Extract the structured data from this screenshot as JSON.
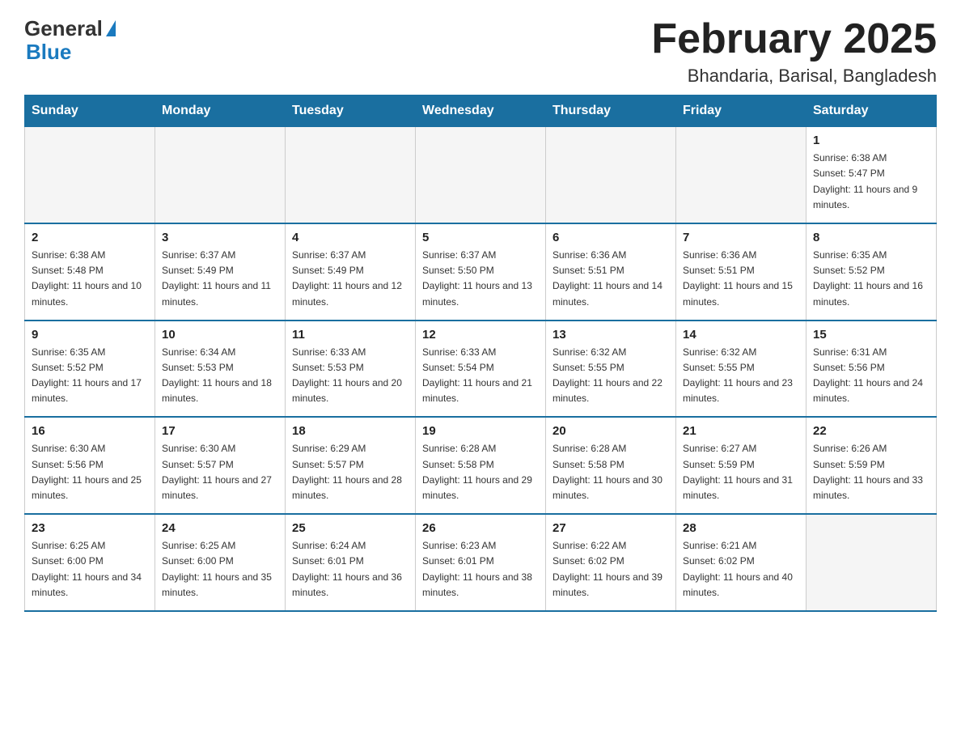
{
  "logo": {
    "general": "General",
    "blue": "Blue"
  },
  "title": "February 2025",
  "location": "Bhandaria, Barisal, Bangladesh",
  "days_of_week": [
    "Sunday",
    "Monday",
    "Tuesday",
    "Wednesday",
    "Thursday",
    "Friday",
    "Saturday"
  ],
  "weeks": [
    [
      {
        "day": "",
        "info": ""
      },
      {
        "day": "",
        "info": ""
      },
      {
        "day": "",
        "info": ""
      },
      {
        "day": "",
        "info": ""
      },
      {
        "day": "",
        "info": ""
      },
      {
        "day": "",
        "info": ""
      },
      {
        "day": "1",
        "info": "Sunrise: 6:38 AM\nSunset: 5:47 PM\nDaylight: 11 hours and 9 minutes."
      }
    ],
    [
      {
        "day": "2",
        "info": "Sunrise: 6:38 AM\nSunset: 5:48 PM\nDaylight: 11 hours and 10 minutes."
      },
      {
        "day": "3",
        "info": "Sunrise: 6:37 AM\nSunset: 5:49 PM\nDaylight: 11 hours and 11 minutes."
      },
      {
        "day": "4",
        "info": "Sunrise: 6:37 AM\nSunset: 5:49 PM\nDaylight: 11 hours and 12 minutes."
      },
      {
        "day": "5",
        "info": "Sunrise: 6:37 AM\nSunset: 5:50 PM\nDaylight: 11 hours and 13 minutes."
      },
      {
        "day": "6",
        "info": "Sunrise: 6:36 AM\nSunset: 5:51 PM\nDaylight: 11 hours and 14 minutes."
      },
      {
        "day": "7",
        "info": "Sunrise: 6:36 AM\nSunset: 5:51 PM\nDaylight: 11 hours and 15 minutes."
      },
      {
        "day": "8",
        "info": "Sunrise: 6:35 AM\nSunset: 5:52 PM\nDaylight: 11 hours and 16 minutes."
      }
    ],
    [
      {
        "day": "9",
        "info": "Sunrise: 6:35 AM\nSunset: 5:52 PM\nDaylight: 11 hours and 17 minutes."
      },
      {
        "day": "10",
        "info": "Sunrise: 6:34 AM\nSunset: 5:53 PM\nDaylight: 11 hours and 18 minutes."
      },
      {
        "day": "11",
        "info": "Sunrise: 6:33 AM\nSunset: 5:53 PM\nDaylight: 11 hours and 20 minutes."
      },
      {
        "day": "12",
        "info": "Sunrise: 6:33 AM\nSunset: 5:54 PM\nDaylight: 11 hours and 21 minutes."
      },
      {
        "day": "13",
        "info": "Sunrise: 6:32 AM\nSunset: 5:55 PM\nDaylight: 11 hours and 22 minutes."
      },
      {
        "day": "14",
        "info": "Sunrise: 6:32 AM\nSunset: 5:55 PM\nDaylight: 11 hours and 23 minutes."
      },
      {
        "day": "15",
        "info": "Sunrise: 6:31 AM\nSunset: 5:56 PM\nDaylight: 11 hours and 24 minutes."
      }
    ],
    [
      {
        "day": "16",
        "info": "Sunrise: 6:30 AM\nSunset: 5:56 PM\nDaylight: 11 hours and 25 minutes."
      },
      {
        "day": "17",
        "info": "Sunrise: 6:30 AM\nSunset: 5:57 PM\nDaylight: 11 hours and 27 minutes."
      },
      {
        "day": "18",
        "info": "Sunrise: 6:29 AM\nSunset: 5:57 PM\nDaylight: 11 hours and 28 minutes."
      },
      {
        "day": "19",
        "info": "Sunrise: 6:28 AM\nSunset: 5:58 PM\nDaylight: 11 hours and 29 minutes."
      },
      {
        "day": "20",
        "info": "Sunrise: 6:28 AM\nSunset: 5:58 PM\nDaylight: 11 hours and 30 minutes."
      },
      {
        "day": "21",
        "info": "Sunrise: 6:27 AM\nSunset: 5:59 PM\nDaylight: 11 hours and 31 minutes."
      },
      {
        "day": "22",
        "info": "Sunrise: 6:26 AM\nSunset: 5:59 PM\nDaylight: 11 hours and 33 minutes."
      }
    ],
    [
      {
        "day": "23",
        "info": "Sunrise: 6:25 AM\nSunset: 6:00 PM\nDaylight: 11 hours and 34 minutes."
      },
      {
        "day": "24",
        "info": "Sunrise: 6:25 AM\nSunset: 6:00 PM\nDaylight: 11 hours and 35 minutes."
      },
      {
        "day": "25",
        "info": "Sunrise: 6:24 AM\nSunset: 6:01 PM\nDaylight: 11 hours and 36 minutes."
      },
      {
        "day": "26",
        "info": "Sunrise: 6:23 AM\nSunset: 6:01 PM\nDaylight: 11 hours and 38 minutes."
      },
      {
        "day": "27",
        "info": "Sunrise: 6:22 AM\nSunset: 6:02 PM\nDaylight: 11 hours and 39 minutes."
      },
      {
        "day": "28",
        "info": "Sunrise: 6:21 AM\nSunset: 6:02 PM\nDaylight: 11 hours and 40 minutes."
      },
      {
        "day": "",
        "info": ""
      }
    ]
  ]
}
